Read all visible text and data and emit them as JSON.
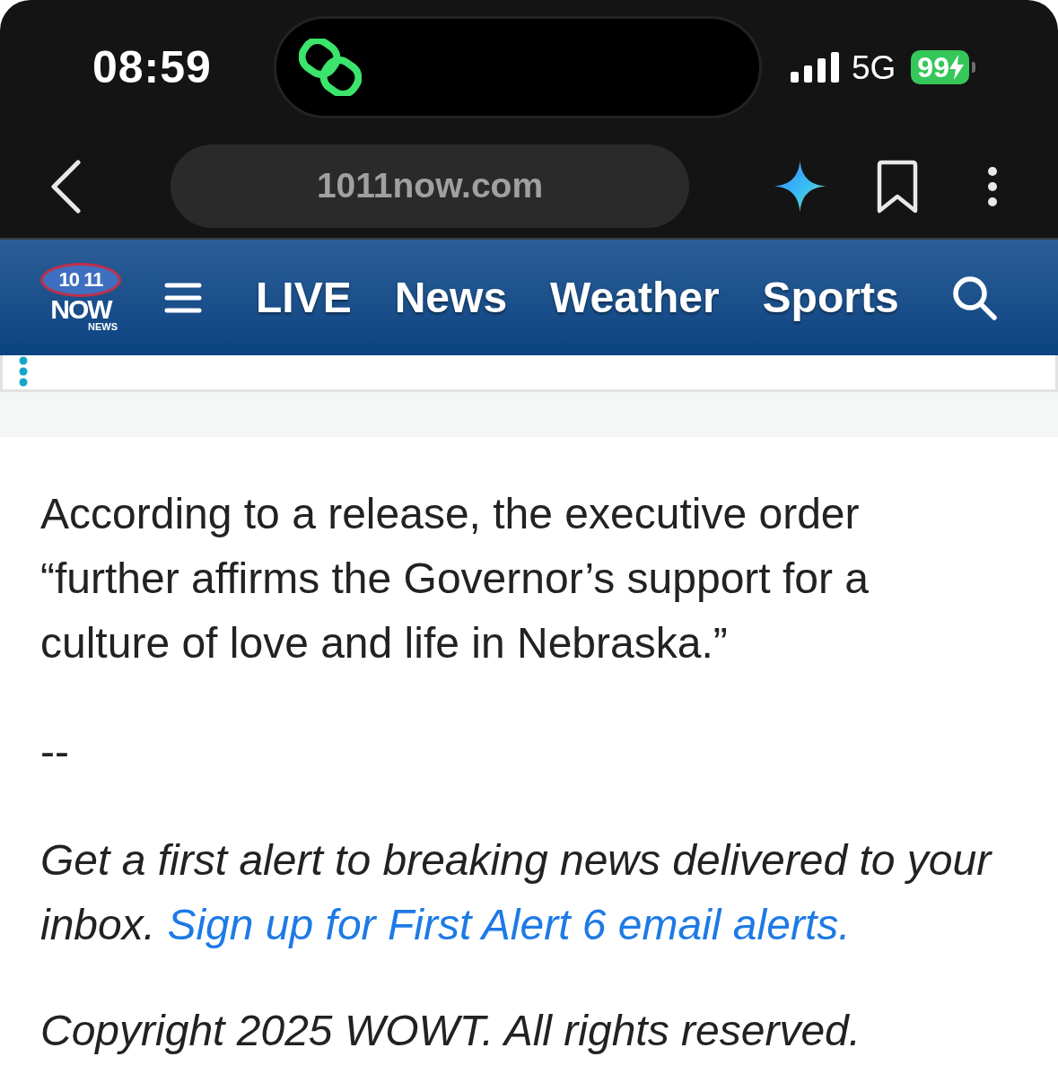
{
  "status_bar": {
    "time": "08:59",
    "network": "5G",
    "battery": "99",
    "charging": true
  },
  "browser": {
    "url": "1011now.com"
  },
  "site_nav": {
    "logo": {
      "number": "10 11",
      "wordmark": "NOW",
      "subtitle": "NEWS"
    },
    "items": [
      {
        "label": "LIVE"
      },
      {
        "label": "News"
      },
      {
        "label": "Weather"
      },
      {
        "label": "Sports"
      }
    ]
  },
  "article": {
    "paragraphs": [
      {
        "kind": "text",
        "text": "According to a release, the executive order “further affirms the Governor’s support for a culture of love and life in Nebraska.”"
      },
      {
        "kind": "text",
        "text": "--"
      },
      {
        "kind": "promo",
        "text": "Get a first alert to breaking news delivered to your inbox.",
        "link": "Sign up for First Alert 6 email alerts."
      },
      {
        "kind": "note",
        "text": "Copyright 2025 WOWT. All rights reserved."
      }
    ]
  }
}
